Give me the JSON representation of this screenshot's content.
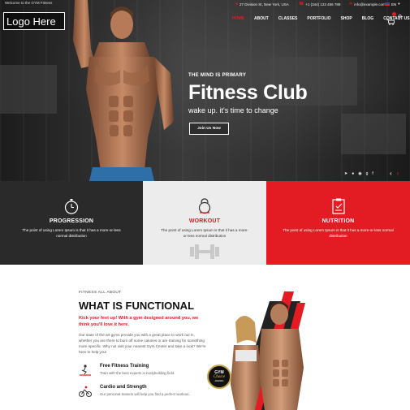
{
  "topbar": {
    "welcome": "Welcome to the GYM Fitness",
    "address": "27 Division St, New York, USA",
    "phone": "+1 (344) 123 456 789",
    "email": "info@example.com",
    "language": "EN"
  },
  "logo": {
    "text": "Logo Here"
  },
  "nav": {
    "items": [
      "HOME",
      "ABOUT",
      "CLASSES",
      "PORTFOLIO",
      "SHOP",
      "BLOG",
      "CONTACT US"
    ],
    "active": "HOME"
  },
  "hero": {
    "eyebrow": "THE MIND IS PRIMARY",
    "title": "Fitness Club",
    "subtitle": "wake up. it's time to change",
    "button": "Join Us Now",
    "social": [
      "share-icon",
      "twitter-icon",
      "pinterest-icon",
      "google-plus-icon",
      "facebook-icon"
    ]
  },
  "features": [
    {
      "title": "PROGRESSION",
      "text": "The point of using Lorem Ipsum is that it has a more-or-less normal distribution",
      "icon": "stopwatch-icon",
      "theme": "dark"
    },
    {
      "title": "WORKOUT",
      "text": "The point of using Lorem Ipsum is that it has a more-or-less normal distribution",
      "icon": "kettlebell-icon",
      "theme": "light"
    },
    {
      "title": "NUTRITION",
      "text": "The point of using Lorem Ipsum is that it has a more-or-less normal distribution",
      "icon": "nutrition-clipboard-icon",
      "theme": "red"
    }
  ],
  "about": {
    "eyebrow": "FITNESS ALL ABOUT",
    "title": "WHAT IS FUNCTIONAL",
    "lead": "Kick your feet up! With a gym designed around you, we think you'll love it here.",
    "body": "Our state of the art gyms provide you with a great place to work out in, whether you are there to burn off some calories or are training for something more specific. Why not visit your nearest Gym Center and take a look? We're here to help you!",
    "bullets": [
      {
        "title": "Free Fitness Training",
        "text": "Train with the best experts in bodybuilding field.",
        "icon": "treadmill-icon"
      },
      {
        "title": "Cardio and Strength",
        "text": "Our personal trainers will help you find a perfect workout.",
        "icon": "cycling-icon"
      }
    ],
    "badge": {
      "line1": "GYM",
      "line2": "Choice",
      "line3": "AWARD"
    }
  },
  "colors": {
    "accent": "#e31b23",
    "dark": "#2a2a2a",
    "light": "#ececec"
  }
}
